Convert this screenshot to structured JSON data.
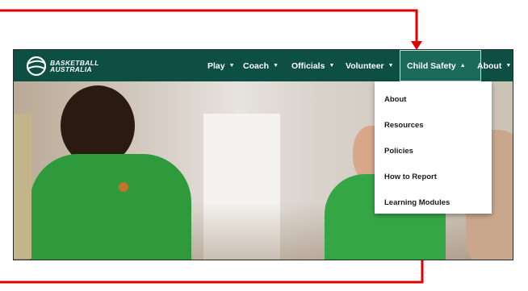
{
  "brand": {
    "logo_line1": "BASKETBALL",
    "logo_line2": "AUSTRALIA"
  },
  "nav": {
    "items": [
      {
        "label": "Play",
        "chevron": "▼",
        "active": false
      },
      {
        "label": "Coach",
        "chevron": "▼",
        "active": false
      },
      {
        "label": "Officials",
        "chevron": "▼",
        "active": false
      },
      {
        "label": "Volunteer",
        "chevron": "▼",
        "active": false
      },
      {
        "label": "Child Safety",
        "chevron": "▲",
        "active": true
      },
      {
        "label": "About",
        "chevron": "▼",
        "active": false
      }
    ]
  },
  "dropdown": {
    "items": [
      {
        "label": "About"
      },
      {
        "label": "Resources"
      },
      {
        "label": "Policies"
      },
      {
        "label": "How to Report"
      },
      {
        "label": "Learning Modules"
      }
    ]
  },
  "colors": {
    "nav_background": "#0d4f43",
    "nav_active": "#1b6a5a",
    "annotation_red": "#e00000",
    "jersey_green": "#2f9a3c"
  },
  "icons": {
    "logo": "basketball-logo-icon",
    "dropdown_arrow": "chevron-down-icon",
    "dropup_arrow": "chevron-up-icon"
  }
}
